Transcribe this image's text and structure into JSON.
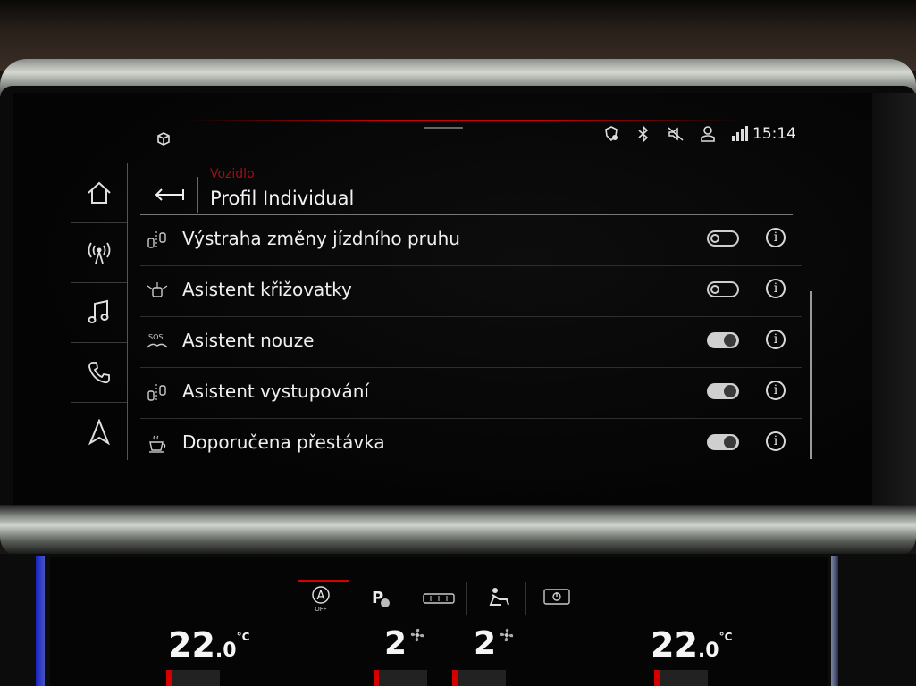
{
  "status_bar": {
    "time": "15:14",
    "icons": [
      "cube-icon",
      "location-shield-icon",
      "bluetooth-icon",
      "mute-icon",
      "user-profile-icon",
      "lte-signal-icon"
    ]
  },
  "rail": [
    "home-icon",
    "radio-icon",
    "music-icon",
    "phone-icon",
    "navigation-icon"
  ],
  "header": {
    "breadcrumb": "Vozidlo",
    "title": "Profil Individual"
  },
  "list": [
    {
      "label": "Výstraha změny jízdního pruhu",
      "icon": "lane-change-warning-icon",
      "on": false
    },
    {
      "label": "Asistent křižovatky",
      "icon": "intersection-assist-icon",
      "on": false
    },
    {
      "label": "Asistent nouze",
      "icon": "emergency-assist-icon",
      "on": true
    },
    {
      "label": "Asistent vystupování",
      "icon": "exit-warning-icon",
      "on": true
    },
    {
      "label": "Doporučena přestávka",
      "icon": "rest-recommendation-icon",
      "on": true
    }
  ],
  "climate": {
    "left_temp_int": "22",
    "left_temp_dec": ".0",
    "right_temp_int": "22",
    "right_temp_dec": ".0",
    "unit": "°C",
    "left_fan": "2",
    "right_fan": "2",
    "auto_label": "A",
    "auto_sub": "OFF",
    "parking_label": "P"
  },
  "colors": {
    "accent_red": "#c00000",
    "text": "#f0f0f0"
  }
}
